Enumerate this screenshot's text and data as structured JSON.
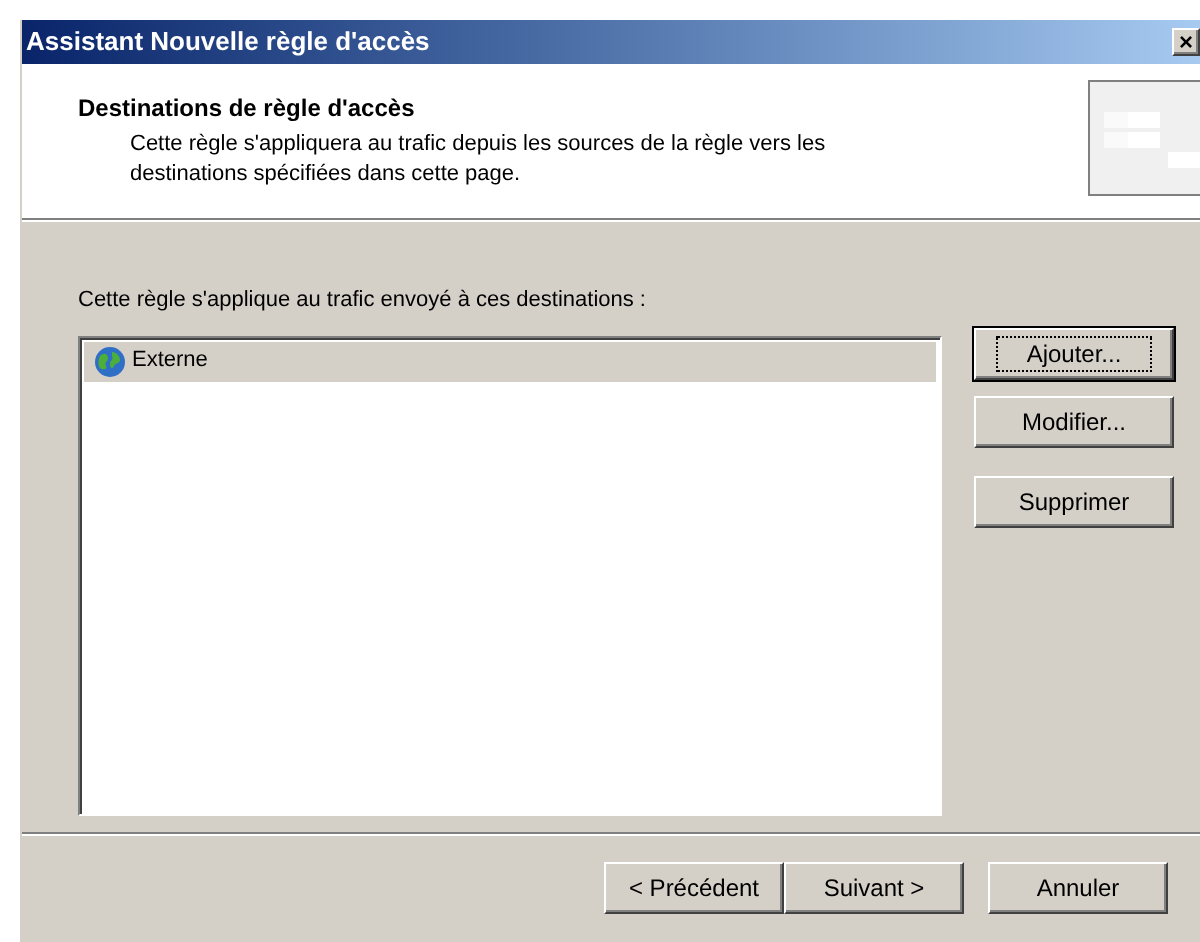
{
  "window": {
    "title": "Assistant Nouvelle règle d'accès",
    "close": "×"
  },
  "header": {
    "title": "Destinations de règle d'accès",
    "description": "Cette règle s'appliquera au trafic depuis les sources de la règle vers les destinations spécifiées dans cette page."
  },
  "list_label": "Cette règle s'applique au trafic envoyé à ces destinations :",
  "destinations": [
    {
      "name": "Externe",
      "selected": true
    }
  ],
  "side_buttons": [
    {
      "label": "Ajouter...",
      "focused": true
    },
    {
      "label": "Modifier...",
      "focused": false
    },
    {
      "label": "Supprimer",
      "focused": false
    }
  ],
  "footer_buttons": [
    "< Précédent",
    "Suivant >",
    "Annuler"
  ]
}
